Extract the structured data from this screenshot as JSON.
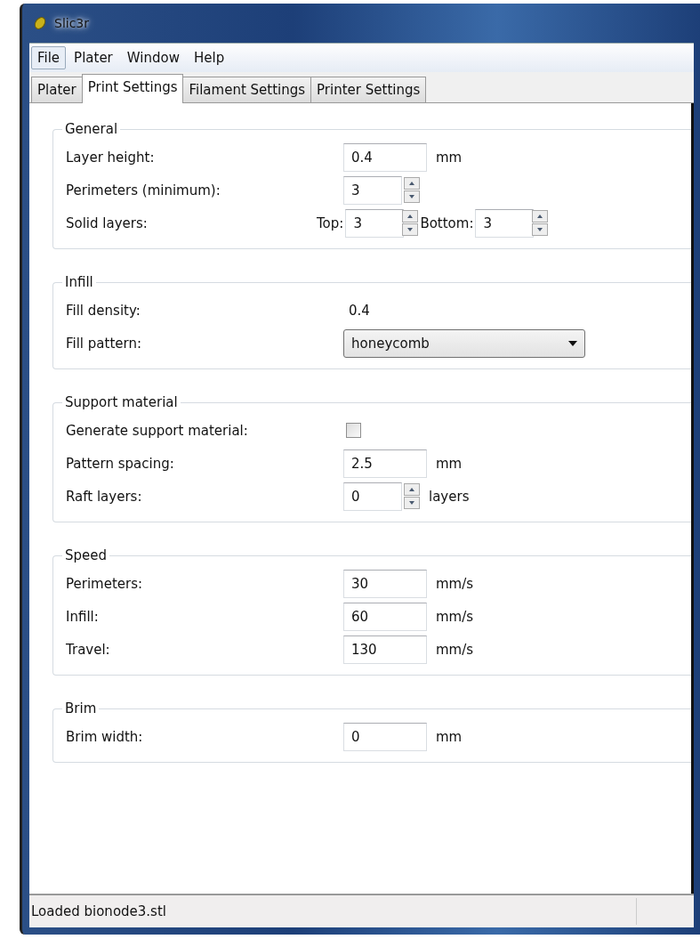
{
  "window": {
    "title": "Slic3r"
  },
  "menu": [
    {
      "label": "File",
      "selected": true
    },
    {
      "label": "Plater",
      "selected": false
    },
    {
      "label": "Window",
      "selected": false
    },
    {
      "label": "Help",
      "selected": false
    }
  ],
  "tabs": [
    {
      "label": "Plater",
      "selected": false
    },
    {
      "label": "Print Settings",
      "selected": true
    },
    {
      "label": "Filament Settings",
      "selected": false
    },
    {
      "label": "Printer Settings",
      "selected": false
    }
  ],
  "sections": [
    {
      "title": "General",
      "rows": [
        {
          "kind": "text",
          "label": "Layer height:",
          "value": "0.4",
          "unit": "mm"
        },
        {
          "kind": "spin",
          "label": "Perimeters (minimum):",
          "value": "3"
        },
        {
          "kind": "pair",
          "label": "Solid layers:",
          "first_label": "Top:",
          "first_value": "3",
          "second_label": "Bottom:",
          "second_value": "3"
        }
      ]
    },
    {
      "title": "Infill",
      "rows": [
        {
          "kind": "static",
          "label": "Fill density:",
          "value": "0.4"
        },
        {
          "kind": "select",
          "label": "Fill pattern:",
          "value": "honeycomb"
        }
      ]
    },
    {
      "title": "Support material",
      "rows": [
        {
          "kind": "checkbox",
          "label": "Generate support material:",
          "checked": false
        },
        {
          "kind": "text",
          "label": "Pattern spacing:",
          "value": "2.5",
          "unit": "mm"
        },
        {
          "kind": "spin",
          "label": "Raft layers:",
          "value": "0",
          "unit": "layers"
        }
      ]
    },
    {
      "title": "Speed",
      "rows": [
        {
          "kind": "text",
          "label": "Perimeters:",
          "value": "30",
          "unit": "mm/s"
        },
        {
          "kind": "text",
          "label": "Infill:",
          "value": "60",
          "unit": "mm/s"
        },
        {
          "kind": "text",
          "label": "Travel:",
          "value": "130",
          "unit": "mm/s"
        }
      ]
    },
    {
      "title": "Brim",
      "rows": [
        {
          "kind": "text",
          "label": "Brim width:",
          "value": "0",
          "unit": "mm"
        }
      ]
    }
  ],
  "status_bar": {
    "text": "Loaded bionode3.stl"
  }
}
